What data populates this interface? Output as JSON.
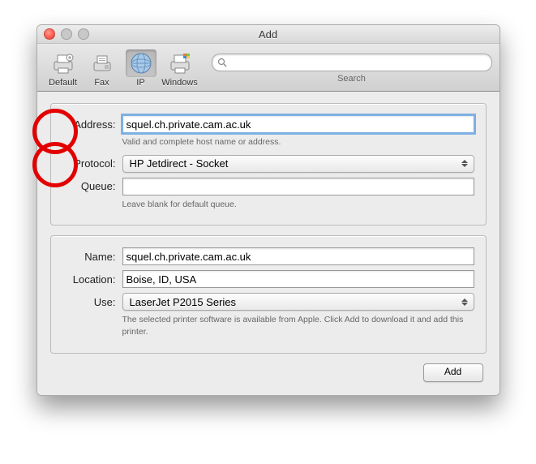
{
  "window": {
    "title": "Add"
  },
  "toolbar": {
    "items": [
      {
        "label": "Default"
      },
      {
        "label": "Fax"
      },
      {
        "label": "IP"
      },
      {
        "label": "Windows"
      }
    ],
    "search": {
      "label": "Search",
      "placeholder": ""
    }
  },
  "labels": {
    "address": "Address:",
    "protocol": "Protocol:",
    "queue": "Queue:",
    "name": "Name:",
    "location": "Location:",
    "use": "Use:"
  },
  "fields": {
    "address": "squel.ch.private.cam.ac.uk",
    "address_hint": "Valid and complete host name or address.",
    "protocol": "HP Jetdirect - Socket",
    "queue": "",
    "queue_hint": "Leave blank for default queue.",
    "name": "squel.ch.private.cam.ac.uk",
    "location": "Boise, ID, USA",
    "use": "LaserJet P2015 Series",
    "use_hint": "The selected printer software is available from Apple. Click Add to download it and add this printer."
  },
  "buttons": {
    "add": "Add"
  }
}
